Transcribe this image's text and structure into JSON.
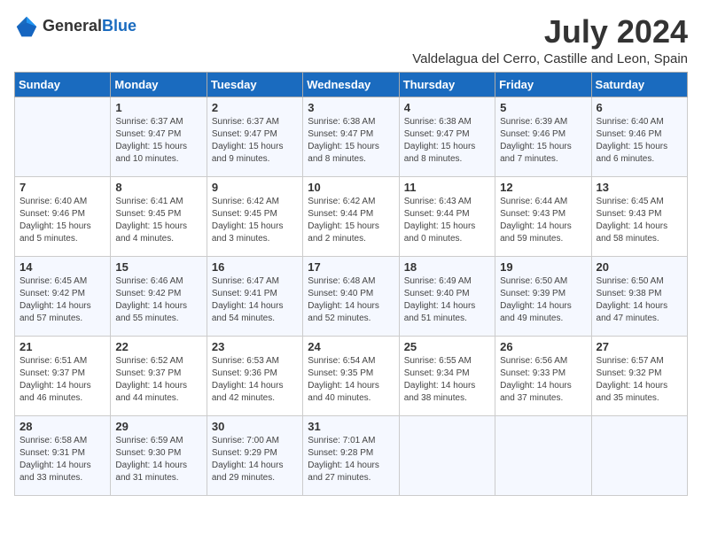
{
  "logo": {
    "text1": "General",
    "text2": "Blue"
  },
  "title": "July 2024",
  "location": "Valdelagua del Cerro, Castille and Leon, Spain",
  "weekdays": [
    "Sunday",
    "Monday",
    "Tuesday",
    "Wednesday",
    "Thursday",
    "Friday",
    "Saturday"
  ],
  "weeks": [
    [
      {
        "day": "",
        "text": ""
      },
      {
        "day": "1",
        "text": "Sunrise: 6:37 AM\nSunset: 9:47 PM\nDaylight: 15 hours\nand 10 minutes."
      },
      {
        "day": "2",
        "text": "Sunrise: 6:37 AM\nSunset: 9:47 PM\nDaylight: 15 hours\nand 9 minutes."
      },
      {
        "day": "3",
        "text": "Sunrise: 6:38 AM\nSunset: 9:47 PM\nDaylight: 15 hours\nand 8 minutes."
      },
      {
        "day": "4",
        "text": "Sunrise: 6:38 AM\nSunset: 9:47 PM\nDaylight: 15 hours\nand 8 minutes."
      },
      {
        "day": "5",
        "text": "Sunrise: 6:39 AM\nSunset: 9:46 PM\nDaylight: 15 hours\nand 7 minutes."
      },
      {
        "day": "6",
        "text": "Sunrise: 6:40 AM\nSunset: 9:46 PM\nDaylight: 15 hours\nand 6 minutes."
      }
    ],
    [
      {
        "day": "7",
        "text": "Sunrise: 6:40 AM\nSunset: 9:46 PM\nDaylight: 15 hours\nand 5 minutes."
      },
      {
        "day": "8",
        "text": "Sunrise: 6:41 AM\nSunset: 9:45 PM\nDaylight: 15 hours\nand 4 minutes."
      },
      {
        "day": "9",
        "text": "Sunrise: 6:42 AM\nSunset: 9:45 PM\nDaylight: 15 hours\nand 3 minutes."
      },
      {
        "day": "10",
        "text": "Sunrise: 6:42 AM\nSunset: 9:44 PM\nDaylight: 15 hours\nand 2 minutes."
      },
      {
        "day": "11",
        "text": "Sunrise: 6:43 AM\nSunset: 9:44 PM\nDaylight: 15 hours\nand 0 minutes."
      },
      {
        "day": "12",
        "text": "Sunrise: 6:44 AM\nSunset: 9:43 PM\nDaylight: 14 hours\nand 59 minutes."
      },
      {
        "day": "13",
        "text": "Sunrise: 6:45 AM\nSunset: 9:43 PM\nDaylight: 14 hours\nand 58 minutes."
      }
    ],
    [
      {
        "day": "14",
        "text": "Sunrise: 6:45 AM\nSunset: 9:42 PM\nDaylight: 14 hours\nand 57 minutes."
      },
      {
        "day": "15",
        "text": "Sunrise: 6:46 AM\nSunset: 9:42 PM\nDaylight: 14 hours\nand 55 minutes."
      },
      {
        "day": "16",
        "text": "Sunrise: 6:47 AM\nSunset: 9:41 PM\nDaylight: 14 hours\nand 54 minutes."
      },
      {
        "day": "17",
        "text": "Sunrise: 6:48 AM\nSunset: 9:40 PM\nDaylight: 14 hours\nand 52 minutes."
      },
      {
        "day": "18",
        "text": "Sunrise: 6:49 AM\nSunset: 9:40 PM\nDaylight: 14 hours\nand 51 minutes."
      },
      {
        "day": "19",
        "text": "Sunrise: 6:50 AM\nSunset: 9:39 PM\nDaylight: 14 hours\nand 49 minutes."
      },
      {
        "day": "20",
        "text": "Sunrise: 6:50 AM\nSunset: 9:38 PM\nDaylight: 14 hours\nand 47 minutes."
      }
    ],
    [
      {
        "day": "21",
        "text": "Sunrise: 6:51 AM\nSunset: 9:37 PM\nDaylight: 14 hours\nand 46 minutes."
      },
      {
        "day": "22",
        "text": "Sunrise: 6:52 AM\nSunset: 9:37 PM\nDaylight: 14 hours\nand 44 minutes."
      },
      {
        "day": "23",
        "text": "Sunrise: 6:53 AM\nSunset: 9:36 PM\nDaylight: 14 hours\nand 42 minutes."
      },
      {
        "day": "24",
        "text": "Sunrise: 6:54 AM\nSunset: 9:35 PM\nDaylight: 14 hours\nand 40 minutes."
      },
      {
        "day": "25",
        "text": "Sunrise: 6:55 AM\nSunset: 9:34 PM\nDaylight: 14 hours\nand 38 minutes."
      },
      {
        "day": "26",
        "text": "Sunrise: 6:56 AM\nSunset: 9:33 PM\nDaylight: 14 hours\nand 37 minutes."
      },
      {
        "day": "27",
        "text": "Sunrise: 6:57 AM\nSunset: 9:32 PM\nDaylight: 14 hours\nand 35 minutes."
      }
    ],
    [
      {
        "day": "28",
        "text": "Sunrise: 6:58 AM\nSunset: 9:31 PM\nDaylight: 14 hours\nand 33 minutes."
      },
      {
        "day": "29",
        "text": "Sunrise: 6:59 AM\nSunset: 9:30 PM\nDaylight: 14 hours\nand 31 minutes."
      },
      {
        "day": "30",
        "text": "Sunrise: 7:00 AM\nSunset: 9:29 PM\nDaylight: 14 hours\nand 29 minutes."
      },
      {
        "day": "31",
        "text": "Sunrise: 7:01 AM\nSunset: 9:28 PM\nDaylight: 14 hours\nand 27 minutes."
      },
      {
        "day": "",
        "text": ""
      },
      {
        "day": "",
        "text": ""
      },
      {
        "day": "",
        "text": ""
      }
    ]
  ]
}
